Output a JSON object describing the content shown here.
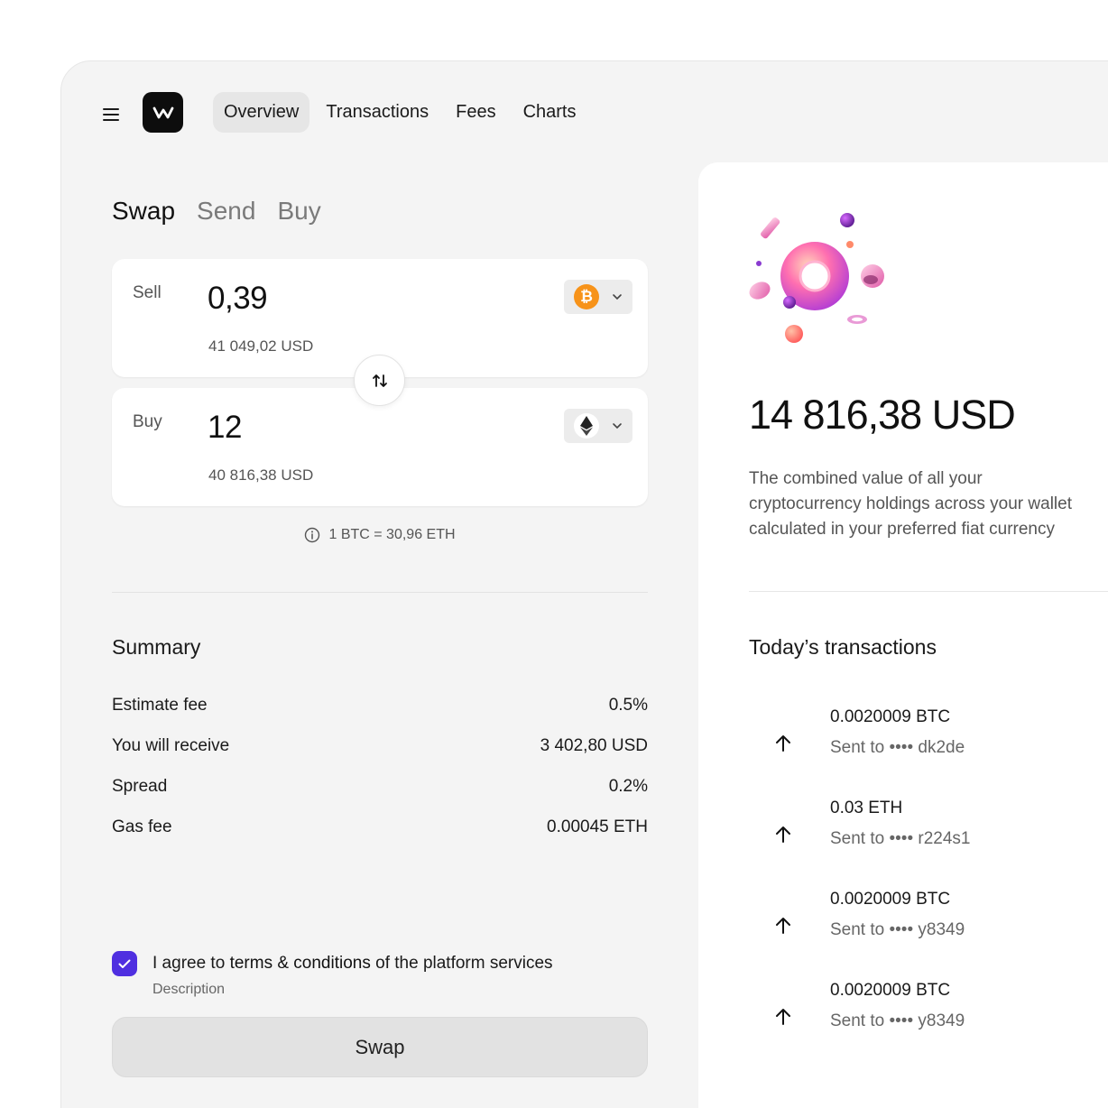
{
  "nav": {
    "items": [
      {
        "label": "Overview",
        "active": true
      },
      {
        "label": "Transactions",
        "active": false
      },
      {
        "label": "Fees",
        "active": false
      },
      {
        "label": "Charts",
        "active": false
      }
    ]
  },
  "subtabs": [
    {
      "label": "Swap",
      "active": true
    },
    {
      "label": "Send",
      "active": false
    },
    {
      "label": "Buy",
      "active": false
    }
  ],
  "sell": {
    "label": "Sell",
    "amount": "0,39",
    "usd": "41 049,02 USD",
    "coin_icon": "bitcoin-icon"
  },
  "buy": {
    "label": "Buy",
    "amount": "12",
    "usd": "40 816,38 USD",
    "coin_icon": "ethereum-icon"
  },
  "rate": "1 BTC = 30,96 ETH",
  "summary": {
    "title": "Summary",
    "rows": [
      {
        "label": "Estimate fee",
        "value": "0.5%"
      },
      {
        "label": "You will receive",
        "value": "3 402,80 USD"
      },
      {
        "label": "Spread",
        "value": "0.2%"
      },
      {
        "label": "Gas fee",
        "value": "0.00045 ETH"
      }
    ]
  },
  "agree": {
    "prefix": "I agree to ",
    "link": "terms & conditions",
    "suffix": " of the platform services",
    "description": "Description",
    "checked": true
  },
  "swap_button": "Swap",
  "portfolio": {
    "balance": "14 816,38 USD",
    "description_lines": [
      "The combined value of all your",
      "cryptocurrency holdings across your wallet",
      "calculated in your preferred fiat currency"
    ]
  },
  "transactions": {
    "title": "Today’s transactions",
    "items": [
      {
        "amount": "0.0020009 BTC",
        "sub": "Sent to •••• dk2de"
      },
      {
        "amount": "0.03 ETH",
        "sub": "Sent to •••• r224s1"
      },
      {
        "amount": "0.0020009 BTC",
        "sub": "Sent to •••• y8349"
      },
      {
        "amount": "0.0020009 BTC",
        "sub": "Sent to •••• y8349"
      }
    ]
  },
  "colors": {
    "accent": "#4f2fe0",
    "bitcoin": "#f7931a",
    "background": "#f4f4f4"
  }
}
